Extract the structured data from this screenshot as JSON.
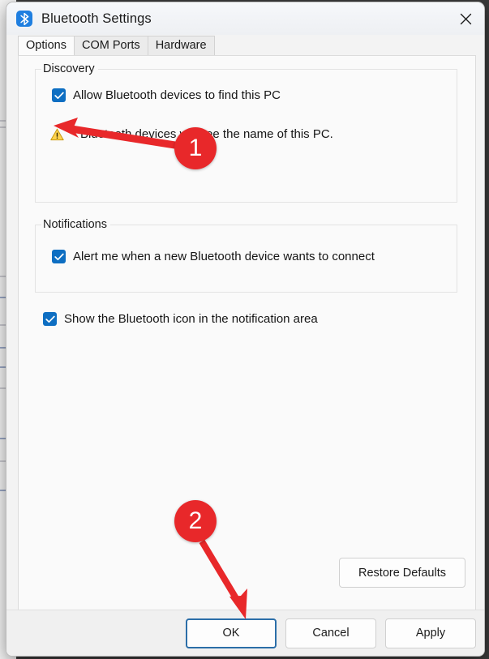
{
  "window": {
    "title": "Bluetooth Settings",
    "app_icon": "bluetooth-icon",
    "close_icon": "close-icon"
  },
  "tabs": [
    {
      "label": "Options",
      "active": true
    },
    {
      "label": "COM Ports",
      "active": false
    },
    {
      "label": "Hardware",
      "active": false
    }
  ],
  "groups": {
    "discovery": {
      "title": "Discovery",
      "checkbox": {
        "label": "Allow Bluetooth devices to find this PC",
        "checked": true
      },
      "warning": {
        "icon": "warning-triangle-icon",
        "text": "Bluetooth devices will see the name of this PC."
      }
    },
    "notifications": {
      "title": "Notifications",
      "checkbox": {
        "label": "Alert me when a new Bluetooth device wants to connect",
        "checked": true
      }
    }
  },
  "standalone_checkbox": {
    "label": "Show the Bluetooth icon in the notification area",
    "checked": true
  },
  "buttons": {
    "restore_defaults": "Restore Defaults",
    "ok": "OK",
    "cancel": "Cancel",
    "apply": "Apply"
  },
  "annotations": [
    {
      "number": "1",
      "target": "allow-bluetooth-devices-checkbox"
    },
    {
      "number": "2",
      "target": "ok-button"
    }
  ],
  "colors": {
    "accent_checkbox": "#0d6ec2",
    "annotation_red": "#e8282a",
    "bluetooth_icon_blue": "#1f7fe0",
    "warning_yellow": "#ffcc33",
    "default_button_border": "#2b6ea8"
  }
}
